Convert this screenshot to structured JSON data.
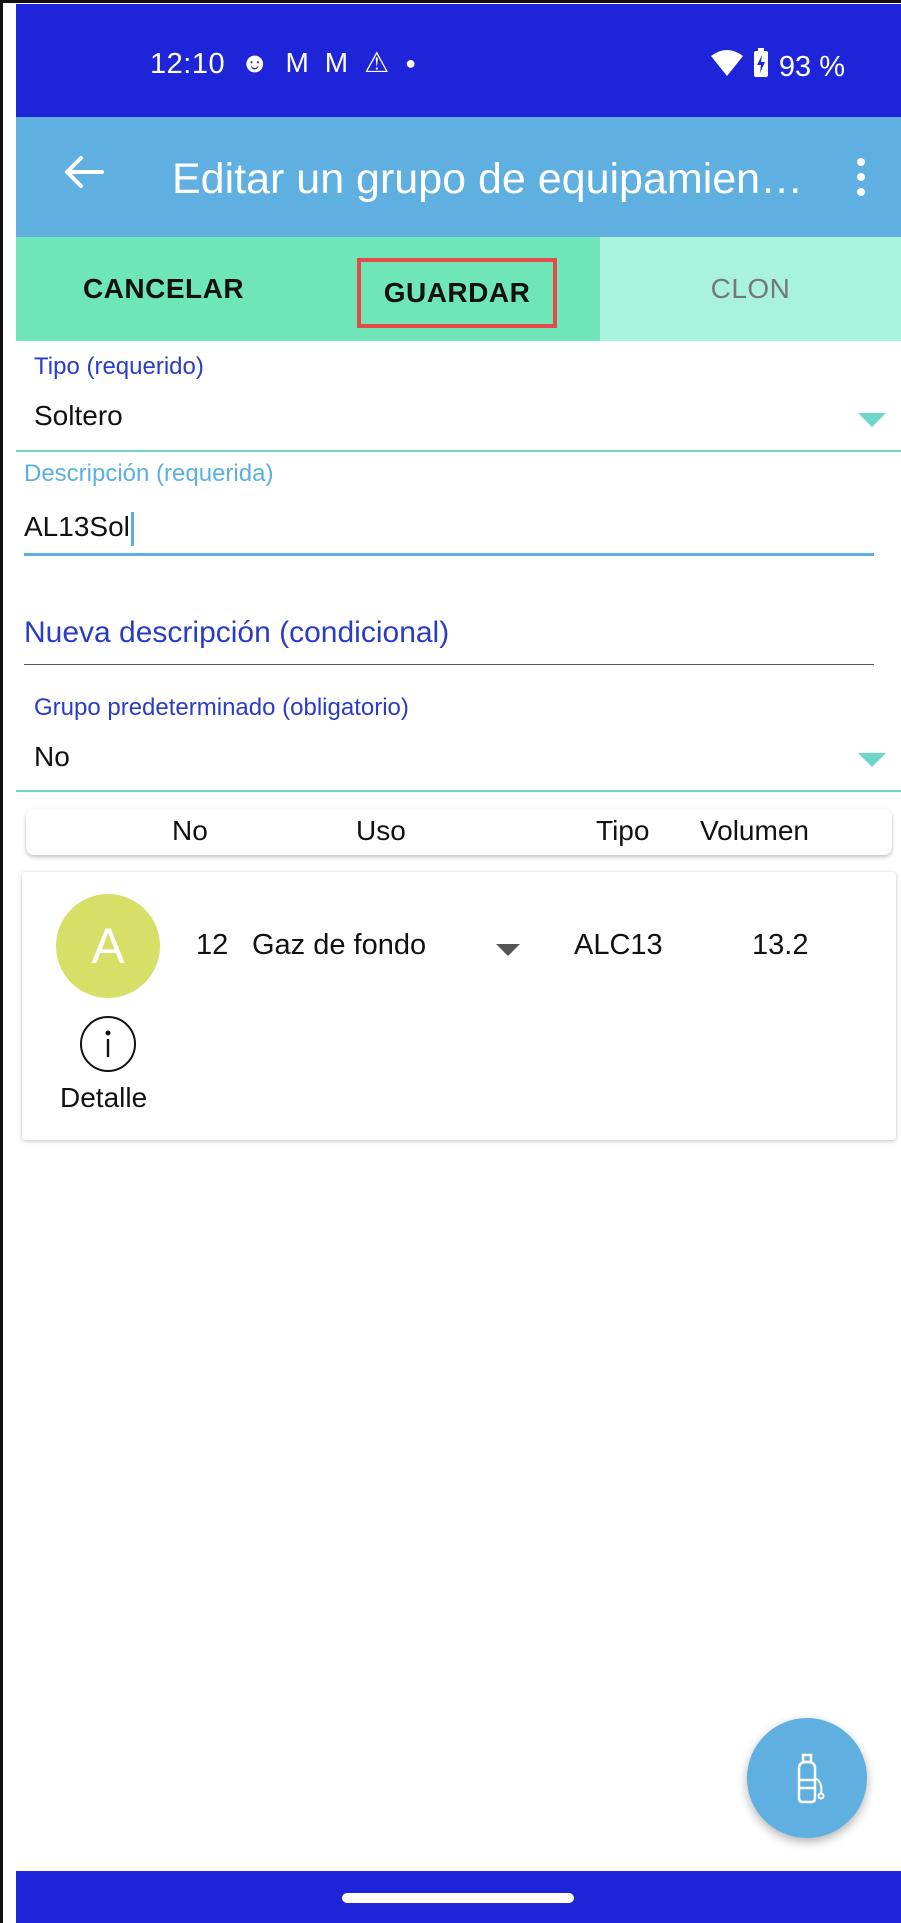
{
  "status_bar": {
    "time": "12:10",
    "battery": "93 %",
    "icons": [
      "face-icon",
      "gmail-icon",
      "gmail-icon",
      "warning-icon",
      "dot-icon",
      "wifi-icon",
      "battery-charging-icon"
    ]
  },
  "app_bar": {
    "title": "Editar un grupo de equipamien…"
  },
  "actions": {
    "cancel": "CANCELAR",
    "save": "GUARDAR",
    "clone": "CLON"
  },
  "form": {
    "tipo": {
      "label": "Tipo (requerido)",
      "value": "Soltero"
    },
    "descripcion": {
      "label": "Descripción (requerida)",
      "value": "AL13Sol"
    },
    "nueva_descripcion": {
      "label": "Nueva descripción (condicional)"
    },
    "grupo": {
      "label": "Grupo predeterminado (obligatorio)",
      "value": "No"
    }
  },
  "table": {
    "headers": {
      "no": "No",
      "uso": "Uso",
      "tipo": "Tipo",
      "volumen": "Volumen"
    },
    "rows": [
      {
        "avatar": "A",
        "no": "12",
        "uso": "Gaz de fondo",
        "tipo": "ALC13",
        "volumen": "13.2",
        "detail": "Detalle"
      }
    ]
  },
  "colors": {
    "status_bar": "#1e24d8",
    "app_bar": "#5fb0e0",
    "action_bar": "#6ee6b8",
    "clone_bg": "#a9f2dc",
    "highlight": "#e34b4b",
    "avatar": "#d6df66"
  }
}
